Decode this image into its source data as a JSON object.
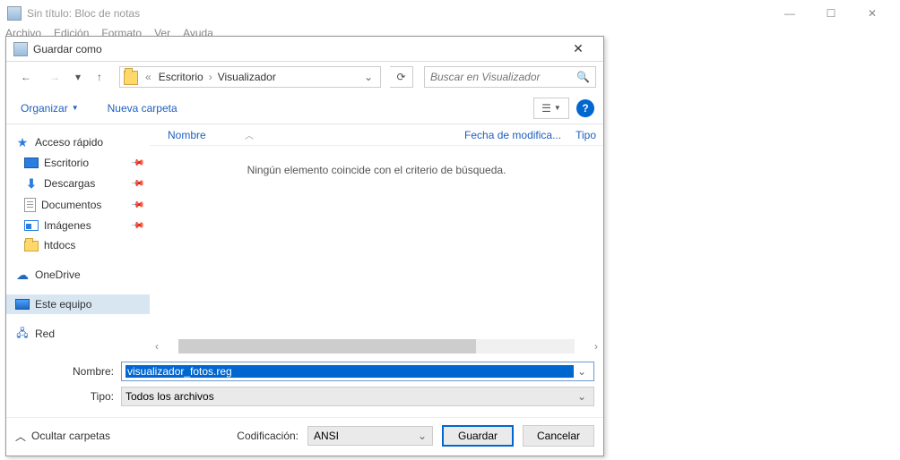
{
  "notepad": {
    "title": "Sin título: Bloc de notas",
    "menu": {
      "archivo": "Archivo",
      "edicion": "Edición",
      "formato": "Formato",
      "ver": "Ver",
      "ayuda": "Ayuda"
    }
  },
  "dialog": {
    "title": "Guardar como",
    "breadcrumb": {
      "p1": "Escritorio",
      "p2": "Visualizador",
      "arrow": "«"
    },
    "search_placeholder": "Buscar en Visualizador",
    "toolbar": {
      "organize": "Organizar",
      "new_folder": "Nueva carpeta"
    },
    "columns": {
      "name": "Nombre",
      "modified": "Fecha de modifica...",
      "type": "Tipo"
    },
    "empty_msg": "Ningún elemento coincide con el criterio de búsqueda.",
    "nav": {
      "quick_access": "Acceso rápido",
      "items": [
        {
          "label": "Escritorio"
        },
        {
          "label": "Descargas"
        },
        {
          "label": "Documentos"
        },
        {
          "label": "Imágenes"
        },
        {
          "label": "htdocs"
        }
      ],
      "onedrive": "OneDrive",
      "this_pc": "Este equipo",
      "network": "Red"
    },
    "fields": {
      "name_label": "Nombre:",
      "name_value": "visualizador_fotos.reg",
      "type_label": "Tipo:",
      "type_value": "Todos los archivos"
    },
    "footer": {
      "hide_folders": "Ocultar carpetas",
      "encoding_label": "Codificación:",
      "encoding_value": "ANSI",
      "save": "Guardar",
      "cancel": "Cancelar"
    },
    "help": "?"
  }
}
